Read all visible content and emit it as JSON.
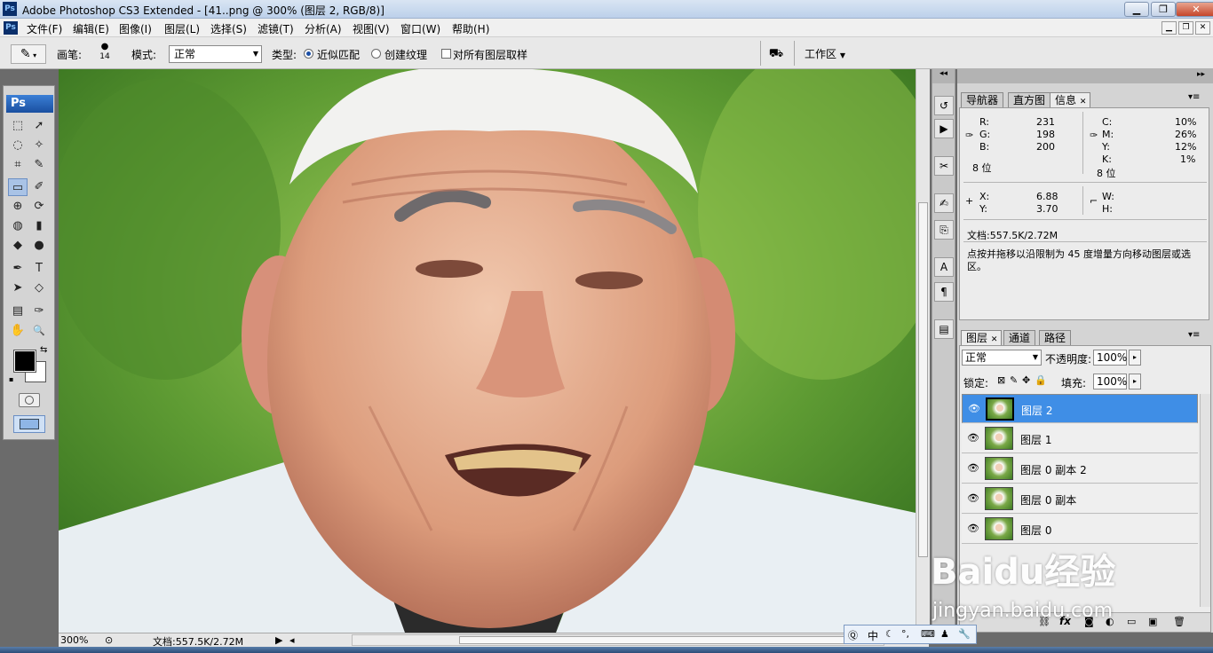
{
  "app": {
    "logo": "Ps",
    "title": "Adobe Photoshop CS3 Extended - [41..png @ 300% (图层 2, RGB/8)]"
  },
  "window_buttons": {
    "minimize": "▁",
    "restore": "❐",
    "close": "✕"
  },
  "menu": {
    "items": [
      "文件(F)",
      "编辑(E)",
      "图像(I)",
      "图层(L)",
      "选择(S)",
      "滤镜(T)",
      "分析(A)",
      "视图(V)",
      "窗口(W)",
      "帮助(H)"
    ]
  },
  "options": {
    "brush_label": "画笔:",
    "brush_size": "14",
    "mode_label": "模式:",
    "mode_value": "正常",
    "type_label": "类型:",
    "radio_proximity": "近似匹配",
    "radio_texture": "创建纹理",
    "sample_all": "对所有图层取样",
    "workspace": "工作区"
  },
  "toolbox": {
    "logo": "Ps",
    "tools": [
      "⬚",
      "➚",
      "◌",
      "✧",
      "⌗",
      "✎",
      "▭",
      "✐",
      "⊕",
      "⟳",
      "◍",
      "▮",
      "◆",
      "●",
      "✒",
      "T",
      "➤",
      "◇",
      "▤",
      "✑",
      "✋",
      "🔍"
    ],
    "selected_tool_index": 4
  },
  "status": {
    "zoom": "300%",
    "doc_size": "文档:557.5K/2.72M"
  },
  "info_panel": {
    "tabs": [
      "导航器",
      "直方图",
      "信息"
    ],
    "active_tab": 2,
    "rgb": {
      "R_label": "R:",
      "R": "231",
      "G_label": "G:",
      "G": "198",
      "B_label": "B:",
      "B": "200"
    },
    "cmyk": {
      "C_label": "C:",
      "C": "10%",
      "M_label": "M:",
      "M": "26%",
      "Y_label": "Y:",
      "Y": "12%",
      "K_label": "K:",
      "K": "1%"
    },
    "bits_left": "8 位",
    "bits_right": "8 位",
    "coords": {
      "X_label": "X:",
      "X": "6.88",
      "Y_label": "Y:",
      "Y": "3.70"
    },
    "size": {
      "W_label": "W:",
      "H_label": "H:"
    },
    "doc": "文档:557.5K/2.72M",
    "hint": "点按并拖移以沿限制为 45 度增量方向移动图层或选区。"
  },
  "layers_panel": {
    "tabs": [
      "图层",
      "通道",
      "路径"
    ],
    "active_tab": 0,
    "blend_mode": "正常",
    "opacity_label": "不透明度:",
    "opacity": "100%",
    "lock_label": "锁定:",
    "fill_label": "填充:",
    "fill": "100%",
    "layers": [
      {
        "name": "图层 2",
        "selected": true
      },
      {
        "name": "图层 1",
        "selected": false
      },
      {
        "name": "图层 0 副本 2",
        "selected": false
      },
      {
        "name": "图层 0 副本",
        "selected": false
      },
      {
        "name": "图层 0",
        "selected": false
      }
    ],
    "bottom_icons": [
      "fx"
    ]
  },
  "ime": {
    "lang": "中"
  },
  "watermark": {
    "text": "Baidu经验",
    "url": "jingyan.baidu.com"
  },
  "colors": {
    "accent": "#3f8ee6",
    "title_bar": "#bcd0ea"
  }
}
